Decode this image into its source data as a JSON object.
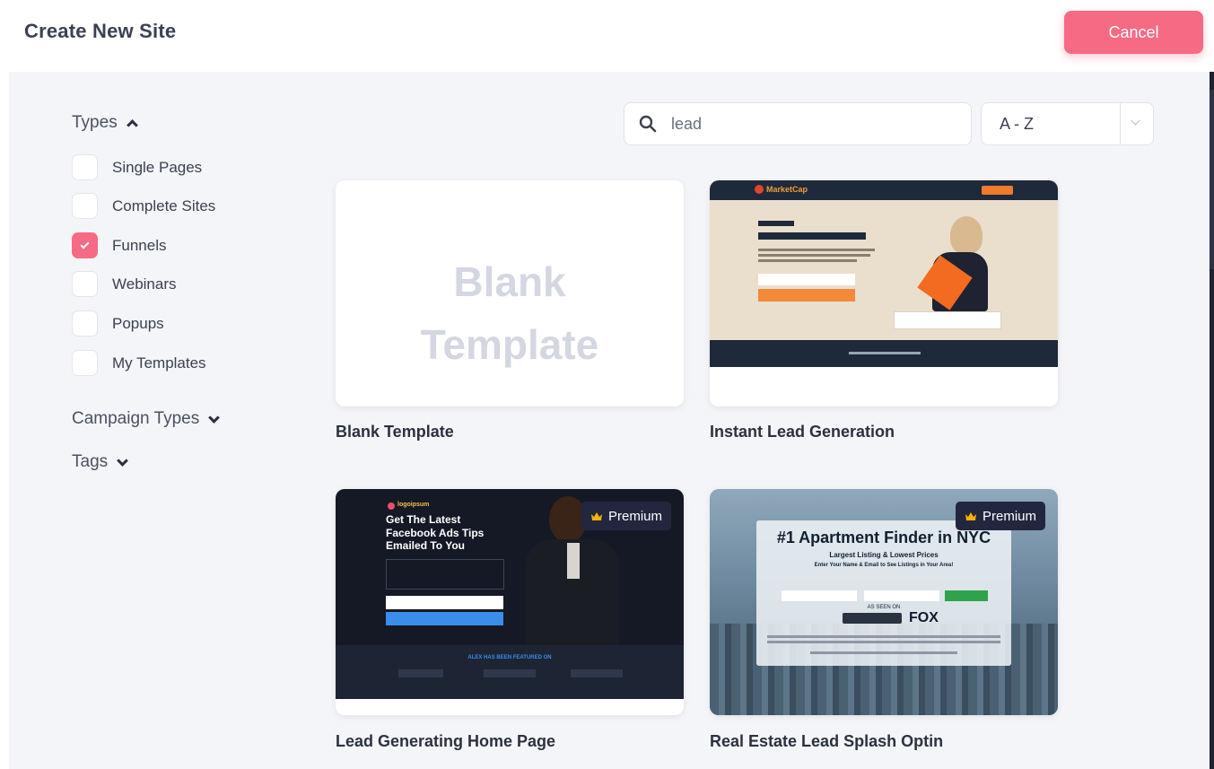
{
  "header": {
    "title": "Create New Site",
    "cancel_label": "Cancel"
  },
  "filters": {
    "types_label": "Types",
    "types": [
      {
        "label": "Single Pages",
        "checked": false
      },
      {
        "label": "Complete Sites",
        "checked": false
      },
      {
        "label": "Funnels",
        "checked": true
      },
      {
        "label": "Webinars",
        "checked": false
      },
      {
        "label": "Popups",
        "checked": false
      },
      {
        "label": "My Templates",
        "checked": false
      }
    ],
    "campaign_types_label": "Campaign Types",
    "tags_label": "Tags"
  },
  "search": {
    "value": "lead"
  },
  "sort": {
    "value": "A - Z"
  },
  "templates": [
    {
      "name": "Blank Template",
      "preview_text_1": "Blank",
      "preview_text_2": "Template"
    },
    {
      "name": "Instant Lead Generation",
      "brand": "MarketCap"
    },
    {
      "name": "Lead Generating Home Page",
      "badge": "Premium",
      "headline": "Get The Latest Facebook Ads Tips Emailed To You",
      "brand": "logoipsum",
      "featured": "ALEX HAS BEEN FEATURED ON"
    },
    {
      "name": "Real Estate Lead Splash Optin",
      "badge": "Premium",
      "headline": "#1 Apartment Finder in NYC",
      "subheadline": "Largest Listing & Lowest Prices",
      "cta_text": "Enter Your Name & Email to See Listings in Your Area!",
      "seen_on": "AS SEEN ON",
      "fox": "FOX"
    }
  ],
  "colors": {
    "accent": "#f76a84",
    "dark": "#23263f"
  }
}
